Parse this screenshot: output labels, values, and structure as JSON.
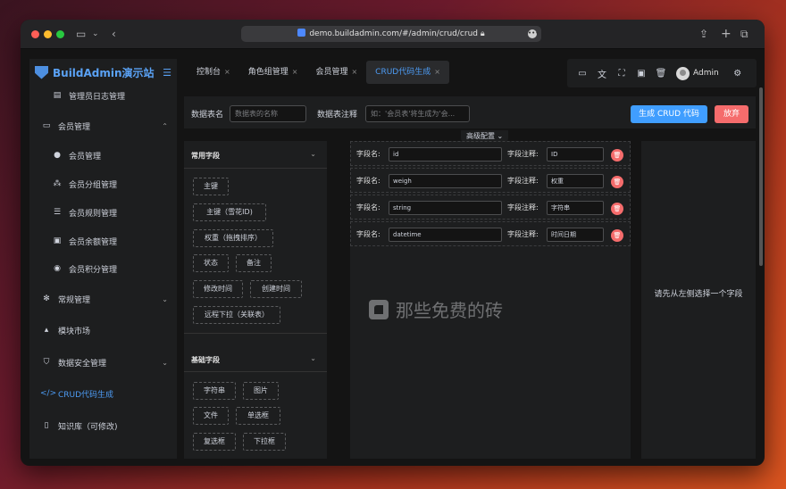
{
  "browser": {
    "url": "demo.buildadmin.com/#/admin/crud/crud",
    "traffic_colors": [
      "#ff5f57",
      "#febc2e",
      "#28c840"
    ]
  },
  "sidebar": {
    "brand": "BuildAdmin演示站",
    "items": [
      {
        "label": "管理员日志管理",
        "icon": "file-icon"
      },
      {
        "label": "会员管理",
        "icon": "id-card-icon",
        "arrow": "⌃"
      },
      {
        "label": "会员管理",
        "icon": "user-icon"
      },
      {
        "label": "会员分组管理",
        "icon": "users-icon"
      },
      {
        "label": "会员规则管理",
        "icon": "list-icon"
      },
      {
        "label": "会员余额管理",
        "icon": "money-icon"
      },
      {
        "label": "会员积分管理",
        "icon": "points-icon"
      },
      {
        "label": "常规管理",
        "icon": "gears-icon",
        "arrow": "⌄"
      },
      {
        "label": "模块市场",
        "icon": "shop-icon"
      },
      {
        "label": "数据安全管理",
        "icon": "shield-icon",
        "arrow": "⌄"
      },
      {
        "label": "CRUD代码生成",
        "icon": "code-icon"
      },
      {
        "label": "知识库（可修改)",
        "icon": "book-icon"
      }
    ]
  },
  "tabs": [
    {
      "label": "控制台"
    },
    {
      "label": "角色组管理"
    },
    {
      "label": "会员管理"
    },
    {
      "label": "CRUD代码生成"
    }
  ],
  "header": {
    "admin_name": "Admin"
  },
  "form": {
    "table_name_label": "数据表名",
    "table_name_placeholder": "数据表的名称",
    "table_comment_label": "数据表注释",
    "table_comment_placeholder": "如：'会员表'将生成为'会...",
    "generate_button": "生成 CRUD 代码",
    "cancel_button": "放弃",
    "advanced_label": "高级配置 ⌄"
  },
  "common_fields": {
    "title": "常用字段",
    "chips": [
      "主键",
      "主键（雪花ID)",
      "权重（拖拽排序）",
      "状态",
      "备注",
      "修改时间",
      "创建时间",
      "远程下拉（关联表）"
    ]
  },
  "basic_fields": {
    "title": "基础字段",
    "chips": [
      "字符串",
      "图片",
      "文件",
      "单选框",
      "复选框",
      "下拉框"
    ]
  },
  "designer": {
    "name_label": "字段名:",
    "comment_label": "字段注释:",
    "fields": [
      {
        "name": "id",
        "comment": "ID"
      },
      {
        "name": "weigh",
        "comment": "权重"
      },
      {
        "name": "string",
        "comment": "字符串"
      },
      {
        "name": "datetime",
        "comment": "时间日期"
      }
    ]
  },
  "right_panel": {
    "hint": "请先从左侧选择一个字段"
  },
  "watermark": "那些免费的砖"
}
